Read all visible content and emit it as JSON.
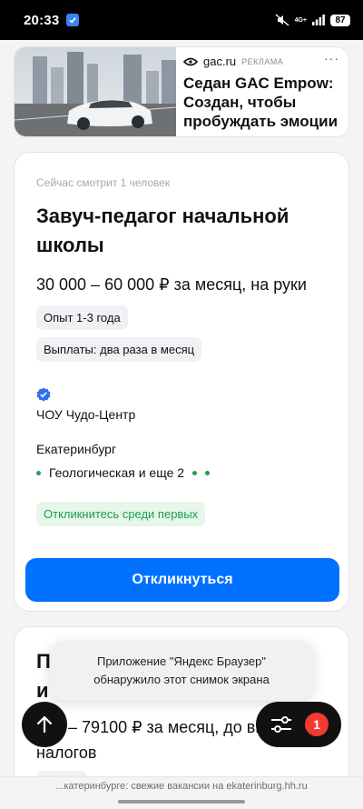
{
  "status_bar": {
    "time": "20:33",
    "network": "4G+",
    "battery": "87"
  },
  "ad": {
    "domain": "gac.ru",
    "tag": "РЕКЛАМА",
    "more": "···",
    "title": "Седан GAC Empow: Создан, чтобы пробуждать эмоции"
  },
  "vacancy": {
    "watching": "Сейчас смотрит 1 человек",
    "title": "Завуч-педагог начальной школы",
    "salary": "30 000 – 60 000 ₽ за месяц, на руки",
    "experience": "Опыт 1-3 года",
    "payouts": "Выплаты: два раза в месяц",
    "company": "ЧОУ Чудо-Центр",
    "city": "Екатеринбург",
    "metro": "Геологическая и еще 2",
    "first_chip": "Откликнитесь среди первых",
    "apply": "Откликнуться"
  },
  "vacancy2": {
    "title_visible": "П",
    "title_line2": "и",
    "salary": "000 – 79100 ₽ за месяц, до вычета налогов"
  },
  "toast": {
    "text": "Приложение \"Яндекс Браузер\" обнаружило этот снимок экрана"
  },
  "filter": {
    "badge": "1"
  },
  "url_bar": {
    "text": "...катеринбурге: свежие вакансии на ekaterinburg.hh.ru"
  },
  "colors": {
    "primary": "#0070ff",
    "success": "#1d9e4d",
    "badge": "#f23b2f"
  }
}
